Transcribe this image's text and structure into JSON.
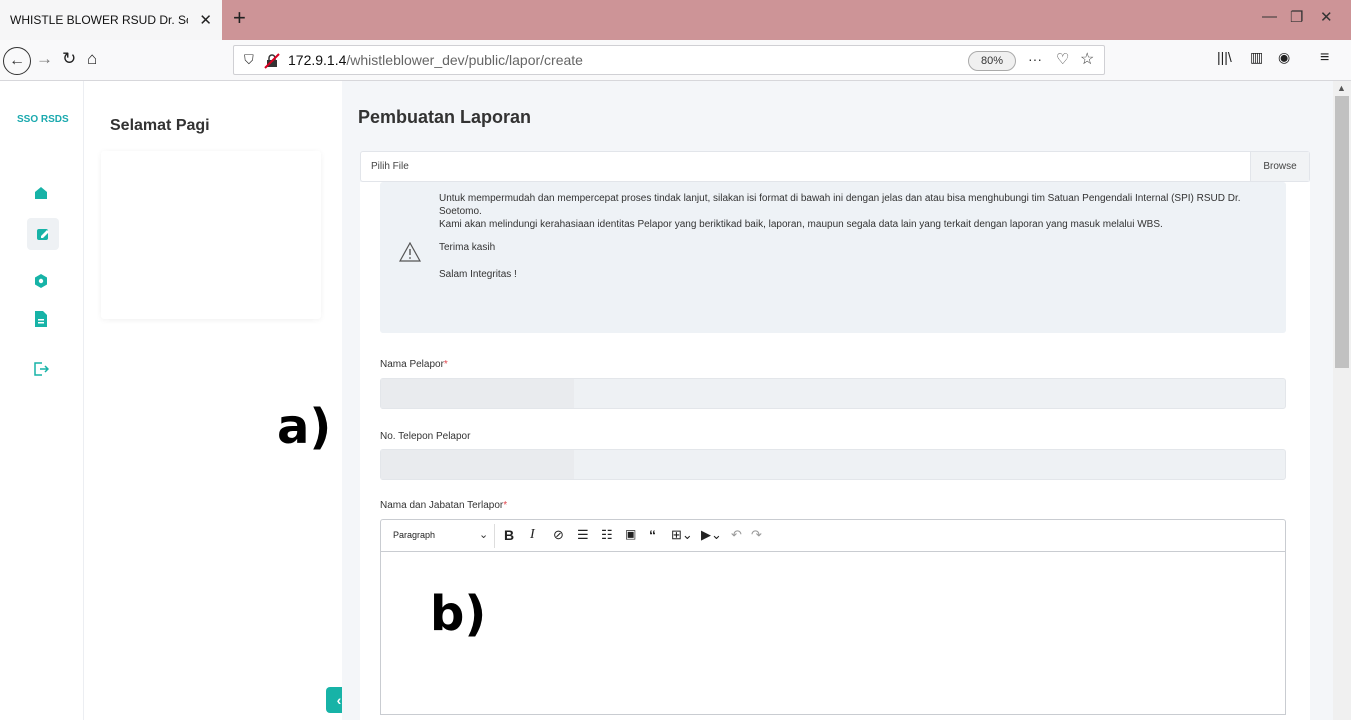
{
  "browser": {
    "tab_title": "WHISTLE BLOWER RSUD Dr. Soetomo",
    "tab_close": "✕",
    "new_tab": "+",
    "url_host": "172.9.1.4",
    "url_path": "/whistleblower_dev/public/lapor/create",
    "zoom": "80%",
    "menu_dots": "···",
    "minimize": "—",
    "restore": "❐",
    "close": "✕"
  },
  "sidebar": {
    "brand": "SSO RSDS",
    "greeting": "Selamat Pagi",
    "accent": "#17b3a7"
  },
  "main": {
    "title": "Pembuatan Laporan",
    "file_label": "Pilih File",
    "browse_label": "Browse",
    "alert": {
      "line1": "Untuk mempermudah dan mempercepat proses tindak lanjut, silakan isi format di bawah ini dengan jelas dan atau bisa menghubungi tim Satuan Pengendali Internal (SPI) RSUD Dr. Soetomo.",
      "line2": "Kami akan melindungi kerahasiaan identitas Pelapor yang beriktikad baik, laporan, maupun segala data lain yang terkait dengan laporan yang masuk melalui WBS.",
      "line3": "Terima kasih",
      "line4": "Salam Integritas !"
    },
    "fields": {
      "nama_pelapor": "Nama Pelapor",
      "telepon_pelapor": "No. Telepon Pelapor",
      "nama_jabatan_terlapor": "Nama dan Jabatan Terlapor",
      "required_mark": "*"
    },
    "editor": {
      "paragraph": "Paragraph"
    }
  },
  "annotations": {
    "a": "a)",
    "b": "b)"
  }
}
